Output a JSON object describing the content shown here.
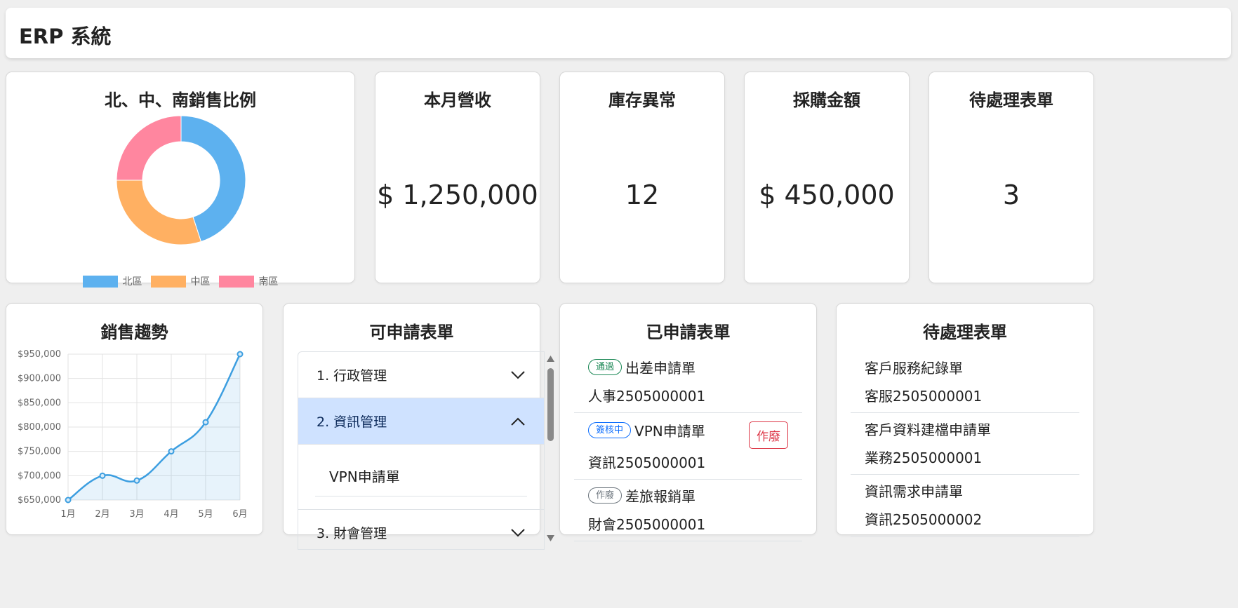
{
  "app": {
    "title": "ERP 系統"
  },
  "donut_card": {
    "title": "北、中、南銷售比例",
    "chart_data": {
      "type": "pie",
      "title": "",
      "categories": [
        "北區",
        "中區",
        "南區"
      ],
      "values": [
        45,
        30,
        25
      ],
      "colors": [
        "#5db1ef",
        "#ffb062",
        "#ff869f"
      ],
      "legend": "bottom"
    }
  },
  "kpis": [
    {
      "title": "本月營收",
      "value": "$ 1,250,000"
    },
    {
      "title": "庫存異常",
      "value": "12"
    },
    {
      "title": "採購金額",
      "value": "$ 450,000"
    },
    {
      "title": "待處理表單",
      "value": "3"
    }
  ],
  "trend_card": {
    "title": "銷售趨勢",
    "chart_data": {
      "type": "area",
      "categories": [
        "1月",
        "2月",
        "3月",
        "4月",
        "5月",
        "6月"
      ],
      "series": [
        {
          "values": [
            650000,
            700000,
            690000,
            750000,
            810000,
            950000
          ]
        }
      ],
      "ylim": [
        650000,
        950000
      ],
      "yticks": [
        "$950,000",
        "$900,000",
        "$850,000",
        "$800,000",
        "$750,000",
        "$700,000",
        "$650,000"
      ],
      "color": "#3c9ee0",
      "grid": true
    }
  },
  "form_catalog": {
    "title": "可申請表單",
    "sections": [
      {
        "label": "1. 行政管理",
        "expanded": false
      },
      {
        "label": "2. 資訊管理",
        "expanded": true,
        "items": [
          "VPN申請單"
        ]
      },
      {
        "label": "3. 財會管理",
        "expanded": false
      }
    ]
  },
  "submitted_forms": {
    "title": "已申請表單",
    "void_label": "作廢",
    "items": [
      {
        "status": "通過",
        "status_color": "#198754",
        "name": "出差申請單",
        "number": "人事2505000001",
        "voidable": false
      },
      {
        "status": "簽核中",
        "status_color": "#0d6efd",
        "name": "VPN申請單",
        "number": "資訊2505000001",
        "voidable": true
      },
      {
        "status": "作廢",
        "status_color": "#6c757d",
        "name": "差旅報銷單",
        "number": "財會2505000001",
        "voidable": false
      }
    ]
  },
  "pending_forms": {
    "title": "待處理表單",
    "items": [
      {
        "name": "客戶服務紀錄單",
        "number": "客服2505000001"
      },
      {
        "name": "客戶資料建檔申請單",
        "number": "業務2505000001"
      },
      {
        "name": "資訊需求申請單",
        "number": "資訊2505000002"
      }
    ]
  }
}
